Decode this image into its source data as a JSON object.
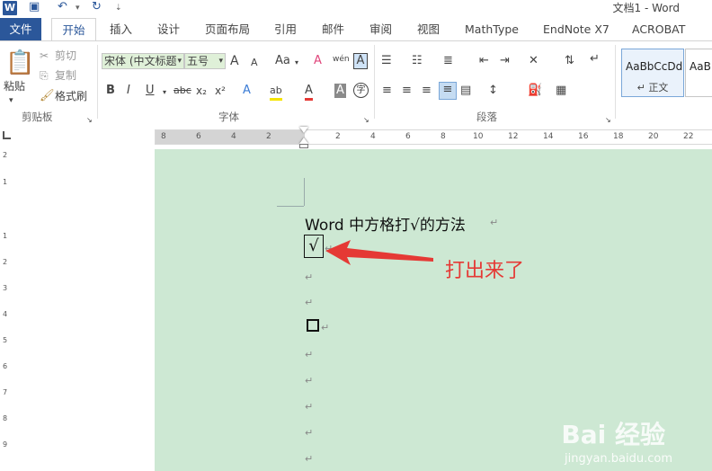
{
  "titlebar": {
    "title": "文档1 - Word"
  },
  "tabs": [
    "文件",
    "开始",
    "插入",
    "设计",
    "页面布局",
    "引用",
    "邮件",
    "审阅",
    "视图",
    "MathType",
    "EndNote X7",
    "ACROBAT"
  ],
  "clipboard": {
    "paste": "粘贴",
    "cut": "剪切",
    "copy": "复制",
    "painter": "格式刷",
    "group": "剪贴板"
  },
  "font": {
    "name": "宋体 (中文标题",
    "size": "五号",
    "group": "字体",
    "grow": "A",
    "shrink": "A",
    "case": "Aa",
    "clear": "A",
    "phonetic": "wén",
    "border": "A",
    "bold": "B",
    "italic": "I",
    "underline": "U",
    "strike": "abc",
    "sub": "x₂",
    "sup": "x²",
    "effect": "A",
    "highlight": "ab",
    "color": "A",
    "shade": "A",
    "circle": "字"
  },
  "paragraph": {
    "group": "段落"
  },
  "styles": [
    {
      "sample": "AaBbCcDd",
      "name": "↵ 正文"
    },
    {
      "sample": "AaB",
      "name": ""
    }
  ],
  "ruler": {
    "ticks_left": [
      "8",
      "6",
      "4",
      "2"
    ],
    "ticks_right": [
      "2",
      "4",
      "6",
      "8",
      "10",
      "12",
      "14",
      "16",
      "18",
      "20",
      "22"
    ]
  },
  "vruler": [
    "2",
    "1",
    "1",
    "2",
    "3",
    "4",
    "5",
    "6",
    "7",
    "8",
    "9"
  ],
  "document": {
    "heading": "Word 中方格打√的方法",
    "checked_box": "√",
    "annotation": "打出来了"
  },
  "watermark": {
    "brand": "Bai 经验",
    "url": "jingyan.baidu.com"
  },
  "colors": {
    "brand_blue": "#2b579a",
    "page_bg": "#cde8d3",
    "arrow_red": "#e53935"
  }
}
